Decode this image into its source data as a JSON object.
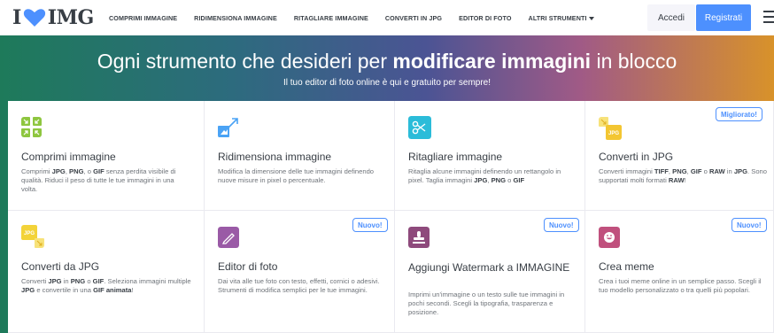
{
  "header": {
    "logo_left": "I",
    "logo_right": "IMG",
    "nav": [
      {
        "label": "COMPRIMI IMMAGINE"
      },
      {
        "label": "RIDIMENSIONA IMMAGINE"
      },
      {
        "label": "RITAGLIARE IMMAGINE"
      },
      {
        "label": "CONVERTI IN JPG"
      },
      {
        "label": "EDITOR DI FOTO"
      },
      {
        "label": "ALTRI STRUMENTI"
      }
    ],
    "login": "Accedi",
    "register": "Registrati"
  },
  "hero": {
    "title_pre": "Ogni strumento che desideri per ",
    "title_bold": "modificare immagini",
    "title_post": " in blocco",
    "subtitle": "Il tuo editor di foto online è qui e gratuito per sempre!"
  },
  "tools": [
    {
      "title": "Comprimi immagine",
      "desc": [
        "Comprimi ",
        "JPG",
        ", ",
        "PNG",
        ", o ",
        "GIF",
        " senza perdita visibile di qualità. Riduci il peso di tutte le tue immagini in una volta."
      ],
      "badge": "",
      "icon": "compress-icon"
    },
    {
      "title": "Ridimensiona immagine",
      "desc": [
        "Modifica la dimensione delle tue immagini definendo nuove misure in pixel o percentuale."
      ],
      "badge": "",
      "icon": "resize-icon"
    },
    {
      "title": "Ritagliare immagine",
      "desc": [
        "Ritaglia alcune immagini definendo un rettangolo in pixel. Taglia immagini ",
        "JPG",
        ", ",
        "PNG",
        " o ",
        "GIF"
      ],
      "badge": "",
      "icon": "crop-icon"
    },
    {
      "title": "Converti in JPG",
      "desc": [
        "Converti immagini ",
        "TIFF",
        ", ",
        "PNG",
        ", ",
        "GIF",
        " o ",
        "RAW",
        " in ",
        "JPG",
        ". Sono supportati molti formati ",
        "RAW",
        "!"
      ],
      "badge": "Migliorato!",
      "icon": "convert-to-jpg-icon"
    },
    {
      "title": "Converti da JPG",
      "desc": [
        "Converti ",
        "JPG",
        " in ",
        "PNG",
        " o ",
        "GIF",
        ". Seleziona immagini multiple ",
        "JPG",
        " e convertile in una ",
        "GIF animata",
        "!"
      ],
      "badge": "",
      "icon": "convert-from-jpg-icon"
    },
    {
      "title": "Editor di foto",
      "desc": [
        "Dai vita alle tue foto con testo, effetti, cornici o adesivi. Strumenti di modifica semplici per le tue immagini."
      ],
      "badge": "Nuovo!",
      "icon": "photo-editor-icon"
    },
    {
      "title": "Aggiungi Watermark a IMMAGINE",
      "desc": [
        "Imprimi un'immagine o un testo sulle tue immagini in pochi secondi. Scegli la tipografia, trasparenza e posizione."
      ],
      "badge": "Nuovo!",
      "icon": "watermark-icon"
    },
    {
      "title": "Crea meme",
      "desc": [
        "Crea i tuoi meme online in un semplice passo. Scegli il tuo modello personalizzato o tra quelli più popolari."
      ],
      "badge": "Nuovo!",
      "icon": "meme-icon"
    }
  ],
  "icon_label": "JPG",
  "colors": {
    "accent": "#4d90fe",
    "heart": "#4d90fe",
    "compress": "#8ec63f",
    "resize": "#4ba3f5",
    "crop": "#2bbcd9",
    "jpg": "#f3d339",
    "editor": "#9a5aa6",
    "watermark": "#8e4a7c",
    "meme": "#c0507d"
  }
}
